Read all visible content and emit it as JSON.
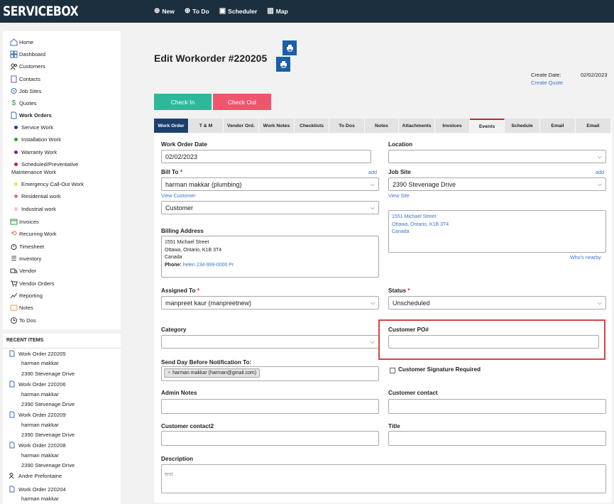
{
  "app": {
    "brand": "SERVICEBOX"
  },
  "topnav": [
    {
      "label": "New",
      "icon": "plus-circle-icon"
    },
    {
      "label": "To Do",
      "icon": "plus-circle-icon"
    },
    {
      "label": "Scheduler",
      "icon": "calendar-icon"
    },
    {
      "label": "Map",
      "icon": "map-icon"
    }
  ],
  "sidebar": {
    "items": [
      {
        "label": "Home",
        "icon": "home-icon"
      },
      {
        "label": "Dashboard",
        "icon": "dashboard-icon"
      },
      {
        "label": "Customers",
        "icon": "users-icon"
      },
      {
        "label": "Contacts",
        "icon": "contacts-icon"
      },
      {
        "label": "Job Sites",
        "icon": "location-icon"
      },
      {
        "label": "Quotes",
        "icon": "dollar-icon"
      },
      {
        "label": "Work Orders",
        "icon": "document-icon"
      }
    ],
    "work_order_types": [
      {
        "label": "Service Work",
        "color": "#1b3fa8"
      },
      {
        "label": "Installation Work",
        "color": "#2aa52a"
      },
      {
        "label": "Warranty Work",
        "color": "#7b1fa2"
      },
      {
        "label": "Scheduled/Preventative",
        "label2": "Maintenance Work",
        "color": "#d32020"
      },
      {
        "label": "Emergency Call-Out Work",
        "color": "#f0e050"
      },
      {
        "label": "Residential work",
        "color": "#e57373"
      },
      {
        "label": "Industrial work",
        "color": "#f4c2c2"
      }
    ],
    "items2": [
      {
        "label": "Invoices",
        "icon": "invoice-icon"
      },
      {
        "label": "Recurring Work",
        "icon": "recurring-icon"
      },
      {
        "label": "Timesheet",
        "icon": "stopwatch-icon"
      },
      {
        "label": "Inventory",
        "icon": "list-icon"
      },
      {
        "label": "Vendor",
        "icon": "truck-icon"
      },
      {
        "label": "Vendor Orders",
        "icon": "cart-icon"
      },
      {
        "label": "Reporting",
        "icon": "trend-icon"
      },
      {
        "label": "Notes",
        "icon": "note-icon"
      },
      {
        "label": "To Dos",
        "icon": "clock-icon"
      }
    ]
  },
  "recent": {
    "header": "RECENT ITEMS",
    "items": [
      {
        "title": "Work Order 220205",
        "customer": "harman makkar",
        "site": "2390 Stevenage Drive"
      },
      {
        "title": "Work Order 220206",
        "customer": "harman makkar",
        "site": "2390 Stevenage Drive"
      },
      {
        "title": "Work Order 220209",
        "customer": "harman makkar",
        "site": "2390 Stevenage Drive"
      },
      {
        "title": "Work Order 220208",
        "customer": "harman makkar",
        "site": "2390 Stevenage Drive"
      }
    ],
    "person": "Andre Prefontaine",
    "last": {
      "title": "Work Order 220204",
      "customer": "harman makkar"
    }
  },
  "page": {
    "title": "Edit Workorder #220205",
    "create_date_label": "Create Date:",
    "create_date_value": "02/02/2023",
    "create_quote": "Create Quote",
    "check_in": "Check In",
    "check_out": "Check Out"
  },
  "tabs": [
    "Work Order",
    "T & M",
    "Vendor Ord.",
    "Work Notes",
    "Checklists",
    "To Dos",
    "Notes",
    "Attachments",
    "Invoices",
    "Events",
    "Schedule",
    "Email",
    "Email"
  ],
  "form": {
    "work_order_date_label": "Work Order Date",
    "work_order_date": "02/02/2023",
    "location_label": "Location",
    "location_value": "",
    "bill_to_label": "Bill To",
    "bill_to_add": "add",
    "bill_to_value": "harman makkar (plumbing)",
    "view_customer": "View Customer",
    "customer_type": "Customer",
    "job_site_label": "Job Site",
    "job_site_add": "add",
    "job_site_value": "2390 Stevenage Drive",
    "view_site": "View Site",
    "site_address": [
      "1551 Michael Street",
      "Ottawa, Ontario, K1B 3T4",
      "Canada"
    ],
    "whos_nearby": "Who's nearby",
    "billing_address_label": "Billing Address",
    "billing_address": [
      "1551 Michael Street",
      "Ottawa, Ontario, K1B 3T4",
      "Canada"
    ],
    "phone_label": "Phone:",
    "phone_value": "helen 234-999-0000 Pr",
    "assigned_to_label": "Assigned To",
    "assigned_to_value": "manpreet kaur (manpreetnew)",
    "status_label": "Status",
    "status_value": "Unscheduled",
    "category_label": "Category",
    "category_value": "",
    "customer_po_label": "Customer PO#",
    "customer_po_value": "",
    "notify_label": "Send Day Before Notification To:",
    "notify_chip": "harman makkar (harman@gmail.com)",
    "signature_label": "Customer Signature Required",
    "admin_notes_label": "Admin Notes",
    "customer_contact_label": "Customer contact",
    "customer_contact2_label": "Customer contact2",
    "title_label": "Title",
    "description_label": "Description",
    "description_value": "test"
  }
}
